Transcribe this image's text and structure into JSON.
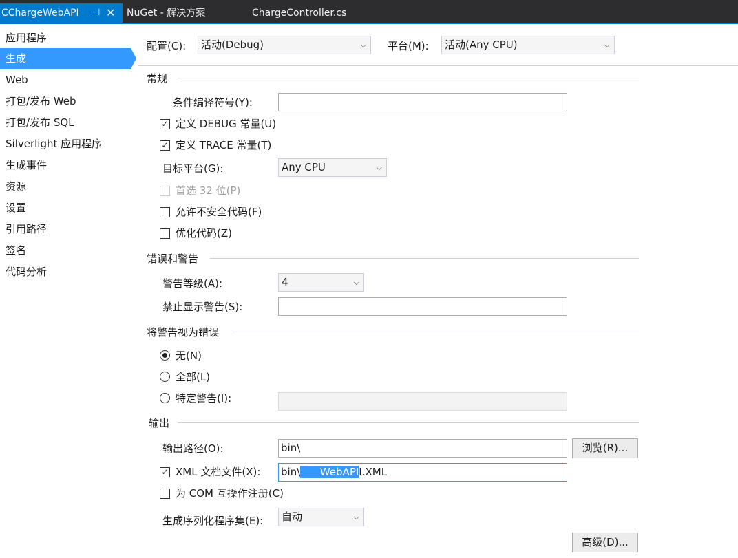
{
  "tabs": {
    "active": "CChargeWebAPI",
    "pin": "⊣",
    "close": "✕",
    "t2": "NuGet - 解决方案",
    "t3": "ChargeController.cs"
  },
  "sidebar": {
    "items": [
      {
        "label": "应用程序"
      },
      {
        "label": "生成"
      },
      {
        "label": "Web"
      },
      {
        "label": "打包/发布 Web"
      },
      {
        "label": "打包/发布 SQL"
      },
      {
        "label": "Silverlight 应用程序"
      },
      {
        "label": "生成事件"
      },
      {
        "label": "资源"
      },
      {
        "label": "设置"
      },
      {
        "label": "引用路径"
      },
      {
        "label": "签名"
      },
      {
        "label": "代码分析"
      }
    ]
  },
  "config": {
    "config_label": "配置(C):",
    "config_value": "活动(Debug)",
    "platform_label": "平台(M):",
    "platform_value": "活动(Any CPU)"
  },
  "general": {
    "title": "常规",
    "symbols_label": "条件编译符号(Y):",
    "symbols_value": "",
    "debug_label": "定义 DEBUG 常量(U)",
    "trace_label": "定义 TRACE 常量(T)",
    "target_label": "目标平台(G):",
    "target_value": "Any CPU",
    "prefer32_label": "首选 32 位(P)",
    "unsafe_label": "允许不安全代码(F)",
    "optimize_label": "优化代码(Z)"
  },
  "errors": {
    "title": "错误和警告",
    "level_label": "警告等级(A):",
    "level_value": "4",
    "suppress_label": "禁止显示警告(S):",
    "suppress_value": ""
  },
  "treat": {
    "title": "将警告视为错误",
    "none_label": "无(N)",
    "all_label": "全部(L)",
    "specific_label": "特定警告(I):"
  },
  "output": {
    "title": "输出",
    "path_label": "输出路径(O):",
    "path_value": "bin\\",
    "browse_label": "浏览(R)...",
    "xml_label": "XML 文档文件(X):",
    "xml_prefix": "bin\\",
    "xml_selected": "      WebAPI",
    "xml_suffix": "I.XML",
    "com_label": "为 COM 互操作注册(C)",
    "serialize_label": "生成序列化程序集(E):",
    "serialize_value": "自动",
    "advanced_label": "高级(D)..."
  },
  "icons": {
    "check": "✓",
    "dropdown": "chevron-down-icon"
  },
  "colors": {
    "accent": "#007acc",
    "selection": "#3399ff",
    "tabbar": "#2d2d30"
  }
}
